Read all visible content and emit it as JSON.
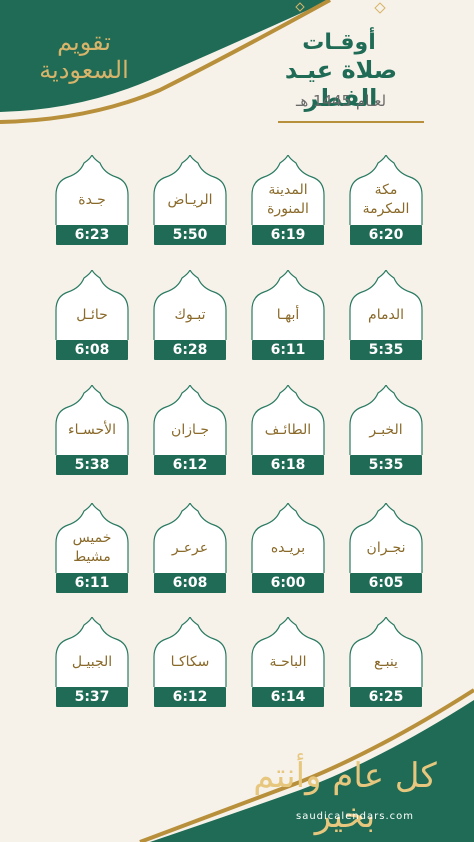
{
  "header": {
    "line1": "أوقـات",
    "line2": "صلاة عيـد الفطر",
    "line3": "لعـام 1445 هـ"
  },
  "brand_text": "تقويم السعودية",
  "footer": {
    "greeting": "كل عام وأنتم بخير",
    "website": "saudicalendars.com"
  },
  "colors": {
    "primary": "#1f6b55",
    "gold": "#b88f3a",
    "background": "#f6f2ea"
  },
  "cities": [
    {
      "name": "مكة المكرمة",
      "time": "6:20"
    },
    {
      "name": "المدينة المنورة",
      "time": "6:19"
    },
    {
      "name": "الريـاض",
      "time": "5:50"
    },
    {
      "name": "جـدة",
      "time": "6:23"
    },
    {
      "name": "الدمام",
      "time": "5:35"
    },
    {
      "name": "أبهـا",
      "time": "6:11"
    },
    {
      "name": "تبـوك",
      "time": "6:28"
    },
    {
      "name": "حائـل",
      "time": "6:08"
    },
    {
      "name": "الخبـر",
      "time": "5:35"
    },
    {
      "name": "الطائـف",
      "time": "6:18"
    },
    {
      "name": "جـازان",
      "time": "6:12"
    },
    {
      "name": "الأحسـاء",
      "time": "5:38"
    },
    {
      "name": "نجـران",
      "time": "6:05"
    },
    {
      "name": "بريـده",
      "time": "6:00"
    },
    {
      "name": "عرعـر",
      "time": "6:08"
    },
    {
      "name": "خميس مشيط",
      "time": "6:11"
    },
    {
      "name": "ينبـع",
      "time": "6:25"
    },
    {
      "name": "الباحـة",
      "time": "6:14"
    },
    {
      "name": "سكاكـا",
      "time": "6:12"
    },
    {
      "name": "الجبيـل",
      "time": "5:37"
    }
  ]
}
